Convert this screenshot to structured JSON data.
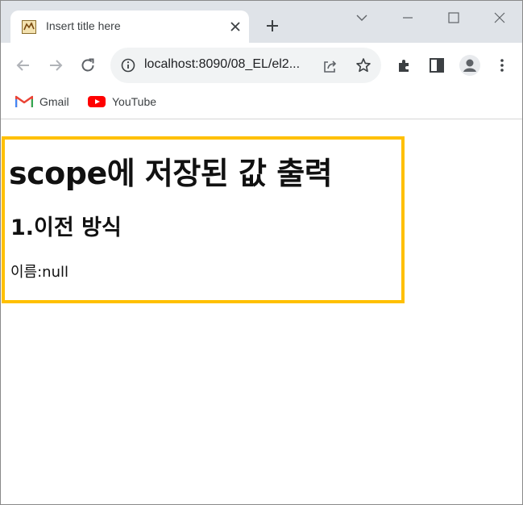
{
  "tab": {
    "title": "Insert title here",
    "favicon": "tomcat-icon"
  },
  "toolbar": {
    "url": "localhost:8090/08_EL/el2..."
  },
  "bookmarks": [
    {
      "label": "Gmail",
      "icon": "gmail-icon"
    },
    {
      "label": "YouTube",
      "icon": "youtube-icon"
    }
  ],
  "page": {
    "heading": "scope에 저장된 값 출력",
    "subheading": "1.이전 방식",
    "name_line": "이름:null"
  },
  "colors": {
    "tabstrip": "#dfe3e8",
    "omnibox": "#f1f3f4",
    "highlight_border": "#ffc000",
    "youtube_red": "#ff0000"
  }
}
